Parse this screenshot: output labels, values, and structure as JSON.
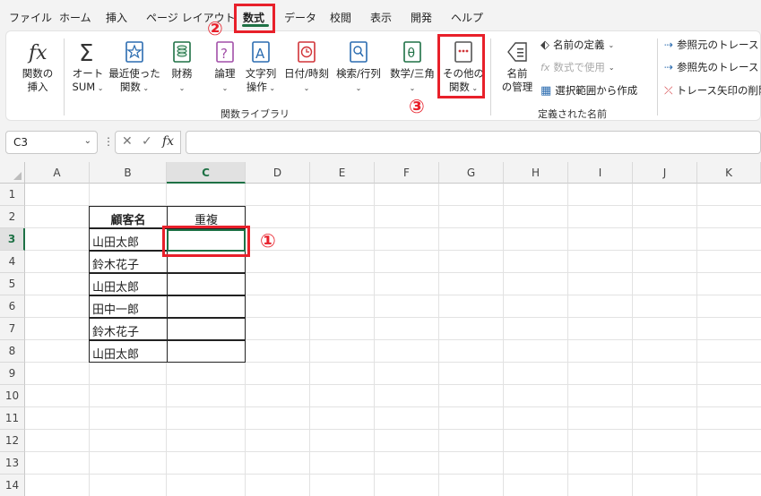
{
  "menubar": {
    "tabs": [
      "ファイル",
      "ホーム",
      "挿入",
      "ページ レイアウト",
      "数式",
      "データ",
      "校閲",
      "表示",
      "開発",
      "ヘルプ"
    ]
  },
  "ribbon": {
    "insert_function": [
      "関数の",
      "挿入"
    ],
    "autosum": [
      "オート",
      "SUM"
    ],
    "recent": [
      "最近使った",
      "関数"
    ],
    "financial": "財務",
    "logical": "論理",
    "text": [
      "文字列",
      "操作"
    ],
    "datetime": "日付/時刻",
    "lookup": "検索/行列",
    "math": "数学/三角",
    "more": [
      "その他の",
      "関数"
    ],
    "library_group": "関数ライブラリ",
    "name_manager": [
      "名前",
      "の管理"
    ],
    "define_name": "名前の定義",
    "use_in_formula": "数式で使用",
    "create_from_selection": "選択範囲から作成",
    "names_group": "定義された名前",
    "trace_precedents": "参照元のトレース",
    "trace_dependents": "参照先のトレース",
    "remove_arrows": "トレース矢印の削除"
  },
  "formula_bar": {
    "name_box": "C3",
    "fx": "fx"
  },
  "grid": {
    "columns": [
      "A",
      "B",
      "C",
      "D",
      "E",
      "F",
      "G",
      "H",
      "I",
      "J",
      "K"
    ],
    "rows": [
      "1",
      "2",
      "3",
      "4",
      "5",
      "6",
      "7",
      "8",
      "9",
      "10",
      "11",
      "12",
      "13",
      "14"
    ]
  },
  "table": {
    "header_name": "顧客名",
    "header_dup": "重複",
    "names": [
      "山田太郎",
      "鈴木花子",
      "山田太郎",
      "田中一郎",
      "鈴木花子",
      "山田太郎"
    ]
  },
  "annotations": [
    "①",
    "②",
    "③"
  ],
  "colors": {
    "accent": "#1e7145",
    "annotation": "#e8202a"
  }
}
